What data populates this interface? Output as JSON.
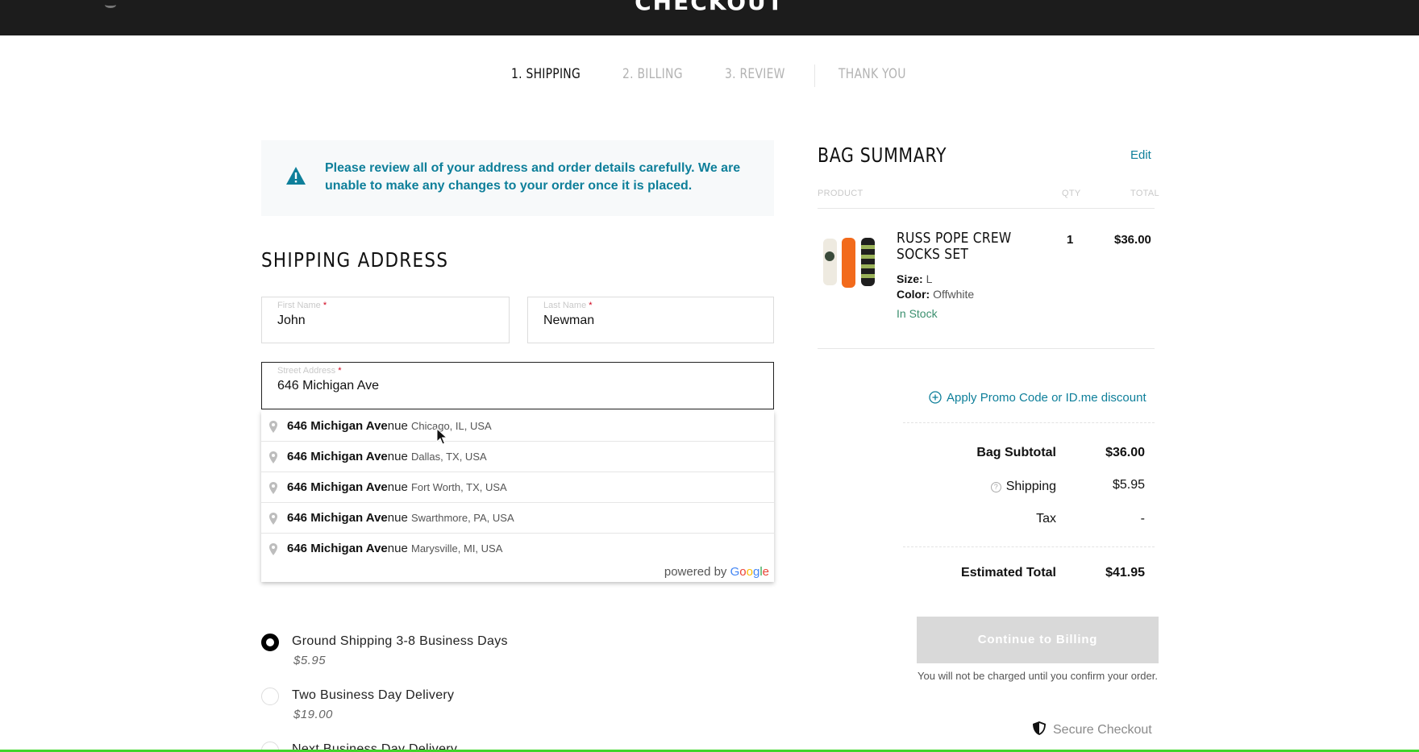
{
  "header": {
    "title": "CHECKOUT"
  },
  "steps": [
    {
      "label": "1. SHIPPING"
    },
    {
      "label": "2. BILLING"
    },
    {
      "label": "3. REVIEW"
    },
    {
      "label": "THANK YOU"
    }
  ],
  "alert": {
    "icon": "warning-icon",
    "message": "Please review all of your address and order details carefully. We are unable to make any changes to your order once it is placed."
  },
  "shipping_address": {
    "title": "SHIPPING ADDRESS",
    "first_name": {
      "label": "First Name",
      "value": "John"
    },
    "last_name": {
      "label": "Last Name",
      "value": "Newman"
    },
    "street": {
      "label": "Street Address",
      "value": "646 Michigan Ave"
    },
    "required_mark": "*"
  },
  "suggestions": {
    "items": [
      {
        "match": "646 Michigan Ave",
        "rest": "nue",
        "secondary": "Chicago, IL, USA"
      },
      {
        "match": "646 Michigan Ave",
        "rest": "nue",
        "secondary": "Dallas, TX, USA"
      },
      {
        "match": "646 Michigan Ave",
        "rest": "nue",
        "secondary": "Fort Worth, TX, USA"
      },
      {
        "match": "646 Michigan Ave",
        "rest": "nue",
        "secondary": "Swarthmore, PA, USA"
      },
      {
        "match": "646 Michigan Ave",
        "rest": "nue",
        "secondary": "Marysville, MI, USA"
      }
    ],
    "powered_by": "powered by",
    "brand": [
      "G",
      "o",
      "o",
      "g",
      "l",
      "e"
    ]
  },
  "shipping_options": [
    {
      "name": "Ground Shipping 3-8 Business Days",
      "price": "$5.95",
      "selected": true
    },
    {
      "name": "Two Business Day Delivery",
      "price": "$19.00",
      "selected": false
    },
    {
      "name": "Next Business Day Delivery",
      "price": "",
      "selected": false
    }
  ],
  "bag": {
    "title": "BAG SUMMARY",
    "edit": "Edit",
    "columns": {
      "product": "PRODUCT",
      "qty": "QTY",
      "total": "TOTAL"
    },
    "item": {
      "name": "RUSS POPE CREW SOCKS SET",
      "size_label": "Size:",
      "size": "L",
      "color_label": "Color:",
      "color": "Offwhite",
      "stock": "In Stock",
      "qty": "1",
      "total": "$36.00"
    },
    "promo": "Apply Promo Code or ID.me discount",
    "summary": {
      "subtotal_label": "Bag Subtotal",
      "subtotal": "$36.00",
      "shipping_label": "Shipping",
      "shipping": "$5.95",
      "tax_label": "Tax",
      "tax": "-",
      "total_label": "Estimated Total",
      "total": "$41.95"
    },
    "cta": "Continue to Billing",
    "note": "You will not be charged until you confirm your order.",
    "secure": "Secure Checkout"
  },
  "colors": {
    "accent": "#0e7f9a",
    "stock": "#3a8f6e",
    "required": "#d0021b",
    "cta_disabled": "#d9d9d9"
  }
}
